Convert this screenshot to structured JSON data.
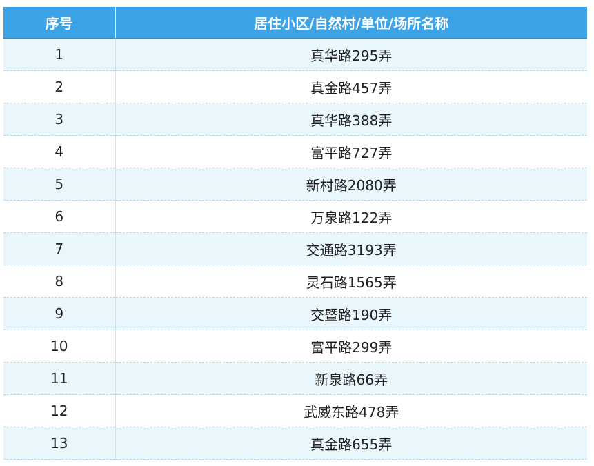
{
  "table": {
    "headers": [
      "序号",
      "居住小区/自然村/单位/场所名称"
    ],
    "rows": [
      {
        "index": "1",
        "name": "真华路295弄"
      },
      {
        "index": "2",
        "name": "真金路457弄"
      },
      {
        "index": "3",
        "name": "真华路388弄"
      },
      {
        "index": "4",
        "name": "富平路727弄"
      },
      {
        "index": "5",
        "name": "新村路2080弄"
      },
      {
        "index": "6",
        "name": "万泉路122弄"
      },
      {
        "index": "7",
        "name": "交通路3193弄"
      },
      {
        "index": "8",
        "name": "灵石路1565弄"
      },
      {
        "index": "9",
        "name": "交暨路190弄"
      },
      {
        "index": "10",
        "name": "富平路299弄"
      },
      {
        "index": "11",
        "name": "新泉路66弄"
      },
      {
        "index": "12",
        "name": "武威东路478弄"
      },
      {
        "index": "13",
        "name": "真金路655弄"
      }
    ]
  },
  "colors": {
    "header_bg": "#3ca3e6",
    "header_text": "#ffffff",
    "row_alt_bg": "#e9f6fc",
    "row_bg": "#ffffff"
  }
}
